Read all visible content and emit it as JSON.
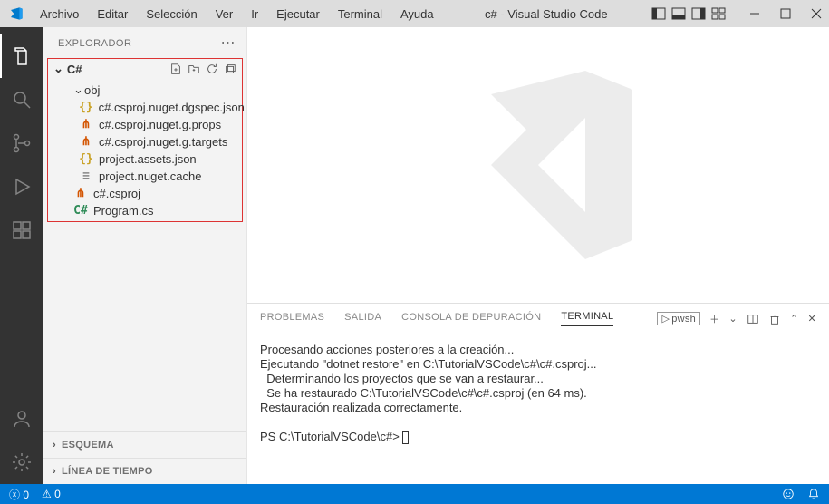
{
  "titlebar": {
    "menus": [
      "Archivo",
      "Editar",
      "Selección",
      "Ver",
      "Ir",
      "Ejecutar",
      "Terminal",
      "Ayuda"
    ],
    "title": "c# - Visual Studio Code"
  },
  "sidebar": {
    "title": "EXPLORADOR",
    "project": "C#",
    "folder": "obj",
    "files": [
      {
        "name": "c#.csproj.nuget.dgspec.json",
        "icon": "json"
      },
      {
        "name": "c#.csproj.nuget.g.props",
        "icon": "xml"
      },
      {
        "name": "c#.csproj.nuget.g.targets",
        "icon": "xml"
      },
      {
        "name": "project.assets.json",
        "icon": "json"
      },
      {
        "name": "project.nuget.cache",
        "icon": "txt"
      }
    ],
    "rootFiles": [
      {
        "name": "c#.csproj",
        "icon": "xml"
      },
      {
        "name": "Program.cs",
        "icon": "cs"
      }
    ],
    "sections": [
      "ESQUEMA",
      "LÍNEA DE TIEMPO"
    ]
  },
  "panel": {
    "tabs": [
      "PROBLEMAS",
      "SALIDA",
      "CONSOLA DE DEPURACIÓN",
      "TERMINAL"
    ],
    "activeTab": "TERMINAL",
    "shell": "pwsh",
    "lines": [
      "Procesando acciones posteriores a la creación...",
      "Ejecutando \"dotnet restore\" en C:\\TutorialVSCode\\c#\\c#.csproj...",
      "  Determinando los proyectos que se van a restaurar...",
      "  Se ha restaurado C:\\TutorialVSCode\\c#\\c#.csproj (en 64 ms).",
      "Restauración realizada correctamente.",
      "",
      "PS C:\\TutorialVSCode\\c#> "
    ]
  },
  "statusbar": {
    "errors": "0",
    "warnings": "0"
  }
}
